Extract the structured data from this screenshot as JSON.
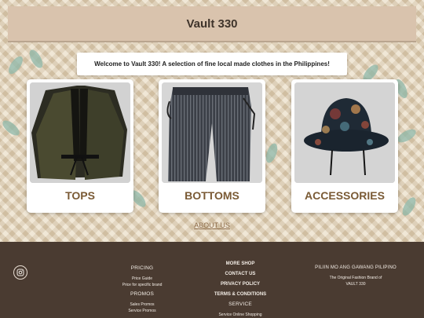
{
  "header": {
    "title": "Vault 330"
  },
  "welcome": {
    "text": "Welcome to Vault 330! A selection of fine local made clothes in the Philippines!"
  },
  "categories": [
    {
      "label": "TOPS",
      "image": "black-kimono-jacket"
    },
    {
      "label": "BOTTOMS",
      "image": "striped-wide-pants"
    },
    {
      "label": "ACCESSORIES",
      "image": "paisley-bucket-hat"
    }
  ],
  "about": {
    "label": "ABOUT US"
  },
  "footer": {
    "social_icon": "instagram-icon",
    "col1": {
      "pricing_heading": "PRICING",
      "pricing_items": [
        "Price Guide",
        "Price for specific brand"
      ],
      "promos_heading": "PROMOS",
      "promos_items": [
        "Sales Promos",
        "Service Promos"
      ]
    },
    "col2": {
      "links": [
        "MORE SHOP",
        "CONTACT US",
        "PRIVACY POLICY",
        "TERMS & CONDITIONS"
      ],
      "service_heading": "SERVICE",
      "service_items": [
        "Service Online Shopping"
      ]
    },
    "col3": {
      "heading": "PILIIN MO ANG GAWANG PILIPINO",
      "line1": "The Original Fashion Brand of",
      "line2": "VAULT 330"
    }
  }
}
